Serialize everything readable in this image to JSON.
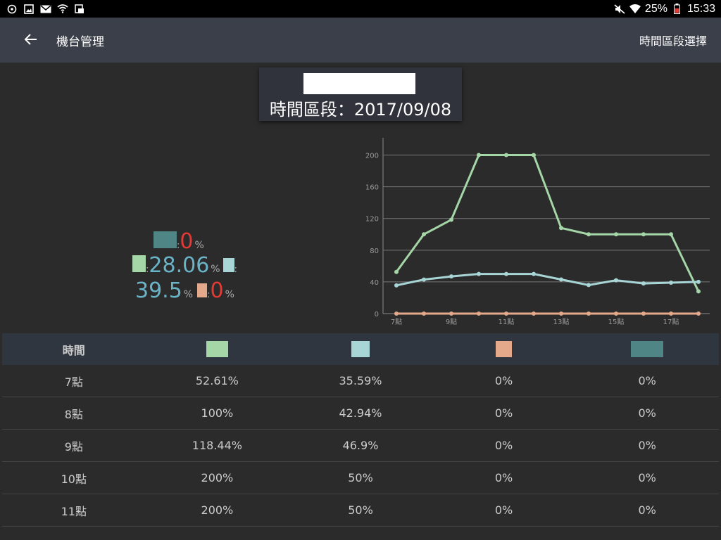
{
  "status_bar": {
    "battery": "25%",
    "time": "15:33",
    "left_icons": [
      "data-saver-icon",
      "image-icon",
      "mail-icon",
      "wifi-alert-icon",
      "news-icon"
    ],
    "right_icons": [
      "mute-icon",
      "wifi-icon",
      "battery-icon"
    ]
  },
  "appbar": {
    "title": "機台管理",
    "action": "時間區段選擇"
  },
  "header": {
    "period": "時間區段：2017/09/08"
  },
  "colors": {
    "green": "#a5d6a7",
    "light_teal": "#a8d5d6",
    "peach": "#e3a98a",
    "dark_teal": "#4f8584"
  },
  "stats": {
    "dark_teal_value": "0",
    "green_value": "28.06",
    "light_teal_value": "39.5",
    "peach_value": "0",
    "colon": ":",
    "percent": "%"
  },
  "chart_data": {
    "type": "line",
    "categories": [
      "7點",
      "8點",
      "9點",
      "10點",
      "11點",
      "12點",
      "13點",
      "14點",
      "15點",
      "16點",
      "17點",
      "18點"
    ],
    "tick_labels": [
      "7點",
      "9點",
      "11點",
      "13點",
      "15點",
      "17點"
    ],
    "ylim": [
      0,
      220
    ],
    "yticks": [
      0,
      40,
      80,
      120,
      160,
      200
    ],
    "grid": true,
    "series": [
      {
        "color": "#a5d6a7",
        "values": [
          52.61,
          100,
          118.44,
          200,
          200,
          200,
          108,
          100,
          100,
          100,
          100,
          28
        ]
      },
      {
        "color": "#a8d5d6",
        "values": [
          35.59,
          42.94,
          46.9,
          50,
          50,
          50,
          43,
          36,
          42,
          38,
          39,
          40
        ]
      },
      {
        "color": "#e3a98a",
        "values": [
          0,
          0,
          0,
          0,
          0,
          0,
          0,
          0,
          0,
          0,
          0,
          0
        ]
      }
    ]
  },
  "table": {
    "header": "時間",
    "rows": [
      {
        "time": "7點",
        "c1": "52.61%",
        "c2": "35.59%",
        "c3": "0%",
        "c4": "0%"
      },
      {
        "time": "8點",
        "c1": "100%",
        "c2": "42.94%",
        "c3": "0%",
        "c4": "0%"
      },
      {
        "time": "9點",
        "c1": "118.44%",
        "c2": "46.9%",
        "c3": "0%",
        "c4": "0%"
      },
      {
        "time": "10點",
        "c1": "200%",
        "c2": "50%",
        "c3": "0%",
        "c4": "0%"
      },
      {
        "time": "11點",
        "c1": "200%",
        "c2": "50%",
        "c3": "0%",
        "c4": "0%"
      }
    ]
  }
}
